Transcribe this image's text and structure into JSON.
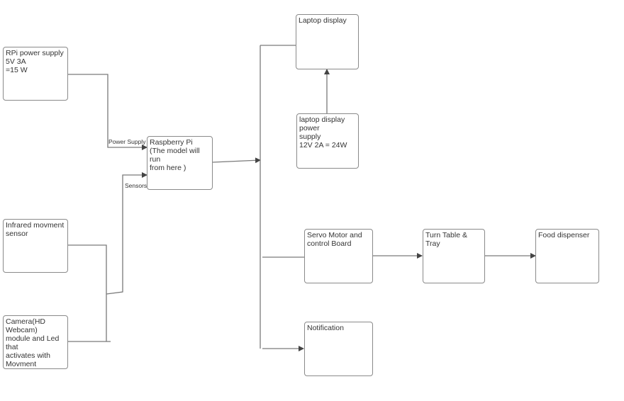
{
  "diagram": {
    "nodes": {
      "rpi_power": "RPi power supply\n5V 3A\n=15 W",
      "raspberry_pi": "Raspberry Pi\n(The model will run\nfrom here )",
      "infrared": "Infrared movment\nsensor",
      "camera": "Camera(HD Webcam)\nmodule and Led that\nactivates with\nMovment",
      "laptop_display": "Laptop display",
      "laptop_power": "laptop display power\nsupply\n12V 2A = 24W",
      "servo": "Servo Motor  and\ncontrol Board",
      "turntable": "Turn Table & Tray",
      "food_dispenser": "Food dispenser",
      "notification": "Notification"
    },
    "edge_labels": {
      "power_supply": "Power Supply",
      "sensors": "Sensors"
    },
    "line_color": "#7a7a7a",
    "arrow_color": "#444444"
  }
}
